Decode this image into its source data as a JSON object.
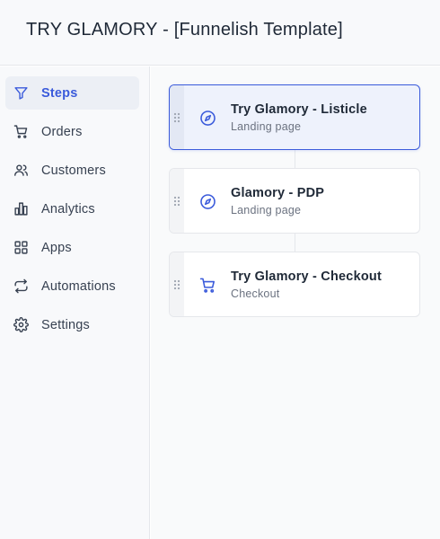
{
  "header": {
    "title": "TRY GLAMORY - [Funnelish Template]"
  },
  "sidebar": {
    "items": [
      {
        "label": "Steps",
        "icon": "filter-icon",
        "active": true
      },
      {
        "label": "Orders",
        "icon": "cart-icon"
      },
      {
        "label": "Customers",
        "icon": "users-icon"
      },
      {
        "label": "Analytics",
        "icon": "bar-chart-icon"
      },
      {
        "label": "Apps",
        "icon": "grid-icon"
      },
      {
        "label": "Automations",
        "icon": "repeat-icon"
      },
      {
        "label": "Settings",
        "icon": "gear-icon"
      }
    ]
  },
  "steps": [
    {
      "title": "Try Glamory - Listicle",
      "subtitle": "Landing page",
      "icon": "compass-icon",
      "selected": true
    },
    {
      "title": "Glamory - PDP",
      "subtitle": "Landing page",
      "icon": "compass-icon"
    },
    {
      "title": "Try Glamory - Checkout",
      "subtitle": "Checkout",
      "icon": "cart-icon"
    }
  ],
  "colors": {
    "accent": "#3b5bdb",
    "text": "#1f2937",
    "muted": "#6b7280",
    "border": "#e5e7eb"
  }
}
